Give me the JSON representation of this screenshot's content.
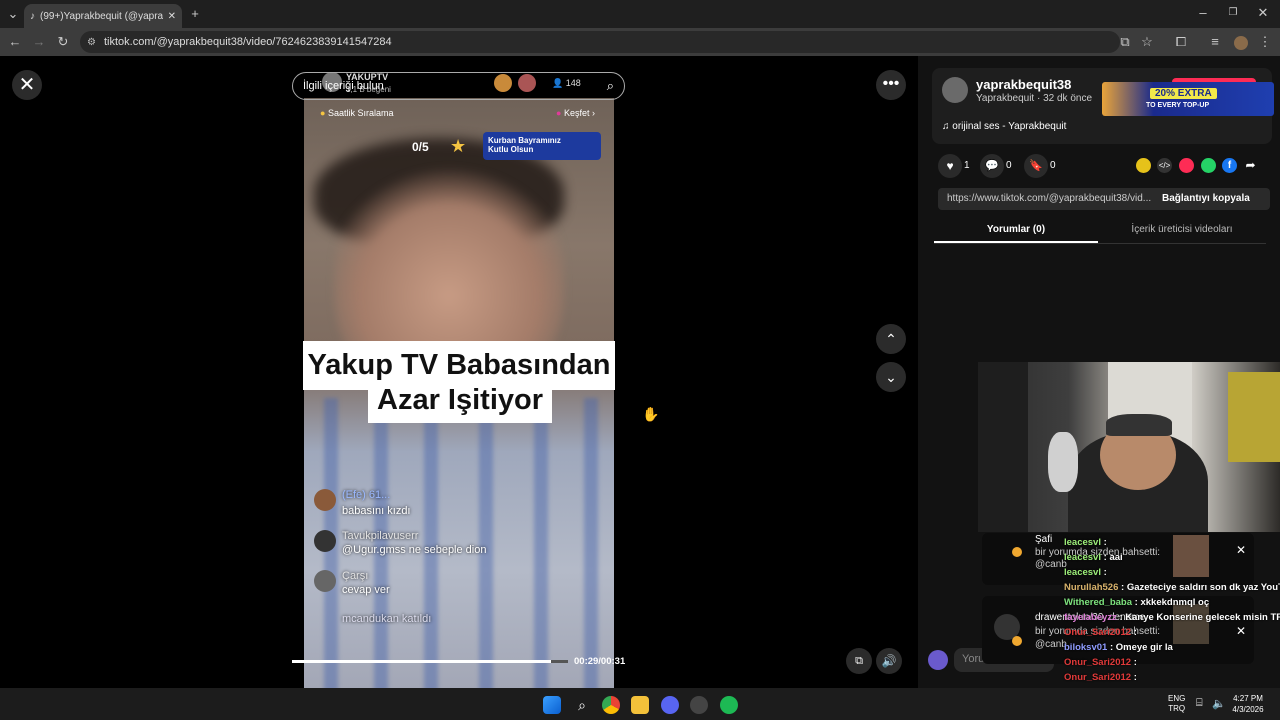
{
  "browser": {
    "tab_title": "(99+)Yaprakbequit (@yaprakbe",
    "url": "tiktok.com/@yaprakbequit38/video/7624623839141547284"
  },
  "video": {
    "search_placeholder": "İlgili içeriği bulun",
    "live_name": "YAKUPTV",
    "live_sub": "1,1 B beğeni",
    "viewer_count": "148",
    "ranking": "Saatlik Sıralama",
    "explore": "Keşfet",
    "counter": "0/5",
    "banner": "Kurban Bayramınız Kutlu Olsun",
    "caption_line1": "Yakup TV Babasından",
    "caption_line2": "Azar Işitiyor",
    "chat": [
      {
        "user": "(Efe) 61...",
        "text": "babasını kızdı"
      },
      {
        "user": "Tavukpilavuserr",
        "text": "@Ugur.gmss ne sebeple dion"
      },
      {
        "user": "Çarşı",
        "text": "cevap ver"
      },
      {
        "user": "",
        "text": "mcandukan katıldı"
      }
    ],
    "time": "00:29/00:31",
    "progress": 0.94
  },
  "post": {
    "username": "yaprakbequit38",
    "subtitle": "Yaprakbequit · 32 dk önce",
    "sound": "orijinal ses - Yaprakbequit",
    "likes": "1",
    "comments": "0",
    "saves": "0",
    "link": "https://www.tiktok.com/@yaprakbequit38/vid...",
    "copy_label": "Bağlantıyı kopyala",
    "tab_comments": "Yorumlar (0)",
    "tab_creator": "İçerik üreticisi videoları",
    "ad_text": "20% EXTRA",
    "ad_sub": "TO EVERY TOP-UP",
    "comment_placeholder": "Yoru"
  },
  "overlay": {
    "notif1_name": "Şafi",
    "notif1_line1": "bir yorumda sizden bahsetti:",
    "notif1_line2": "@canb",
    "notif2_name": "drawentolun/30, deneme",
    "notif2_line1": "bir yorumda sizden bahsetti:",
    "notif2_line2": "@canb",
    "chat": [
      {
        "user": "leacesvl",
        "text": "",
        "color": "#9ef07a"
      },
      {
        "user": "leacesvl",
        "text": "aai",
        "color": "#9ef07a"
      },
      {
        "user": "leacesvl",
        "text": "",
        "color": "#9ef07a"
      },
      {
        "user": "Nurullah526",
        "text": "Gazeteciye saldırı son dk yaz YouTube",
        "color": "#d9b36c"
      },
      {
        "user": "Withered_baba",
        "text": "xkkekdnmql oç",
        "color": "#7ee37e"
      },
      {
        "user": "fayelabeyzz",
        "text": "Kanye Konserine gelecek misin TR'ye",
        "color": "#e07ed9"
      },
      {
        "user": "Onur_Sari2012",
        "text": "",
        "color": "#e03a3a"
      },
      {
        "user": "biloksv01",
        "text": "Omeye gir la",
        "color": "#8f9cff"
      },
      {
        "user": "Onur_Sari2012",
        "text": "",
        "color": "#e03a3a"
      },
      {
        "user": "Onur_Sari2012",
        "text": "",
        "color": "#e03a3a"
      }
    ]
  },
  "taskbar": {
    "lang1": "ENG",
    "lang2": "TRQ",
    "clock": "4:27 PM",
    "date": "4/3/2026"
  }
}
